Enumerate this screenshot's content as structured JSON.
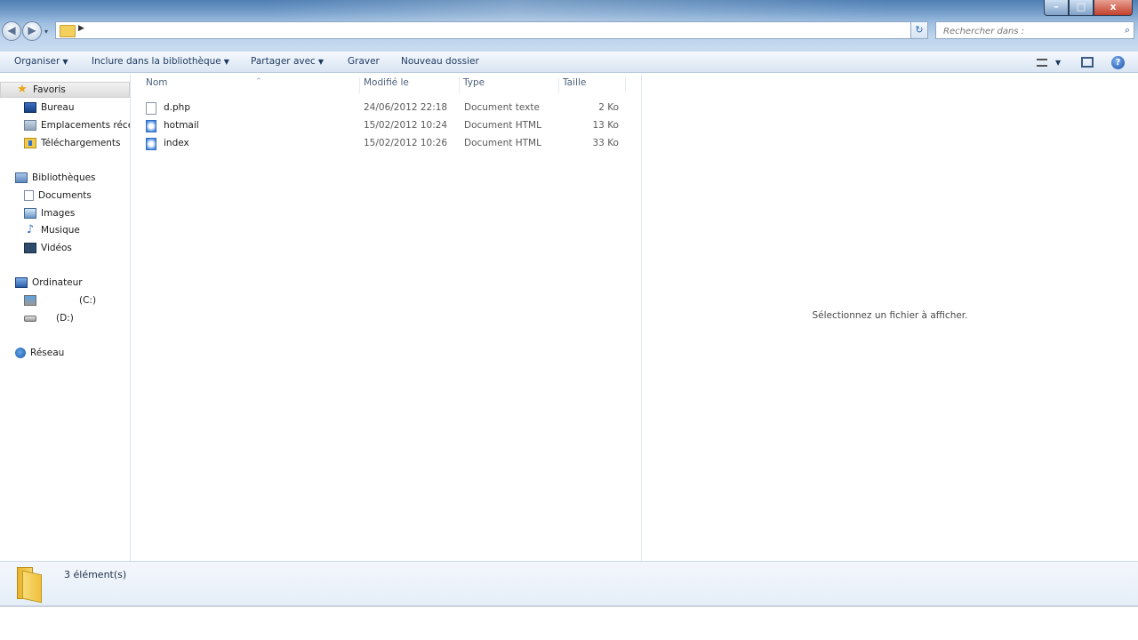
{
  "window": {
    "controls": {
      "minimize": "–",
      "maximize": "□",
      "close": "x"
    }
  },
  "navigation": {
    "back": "◀",
    "forward": "▶",
    "dropdown": "▾",
    "refresh": "↻"
  },
  "address": {
    "separator": "▶",
    "dropdown": "▾"
  },
  "search": {
    "placeholder": "Rechercher dans :"
  },
  "toolbar": {
    "organize": "Organiser",
    "include_library": "Inclure dans la bibliothèque",
    "share": "Partager avec",
    "burn": "Graver",
    "new_folder": "Nouveau dossier",
    "caret": "▼",
    "help": "?"
  },
  "nav": {
    "favorites": "Favoris",
    "desktop": "Bureau",
    "recent": "Emplacements récents",
    "downloads": "Téléchargements",
    "libraries": "Bibliothèques",
    "documents": "Documents",
    "images": "Images",
    "music": "Musique",
    "videos": "Vidéos",
    "computer": "Ordinateur",
    "drive_c": "(C:)",
    "drive_d": "(D:)",
    "network": "Réseau"
  },
  "columns": {
    "name": "Nom",
    "modified": "Modifié le",
    "type": "Type",
    "size": "Taille",
    "sort_indicator": "^"
  },
  "files": [
    {
      "name": "d.php",
      "modified": "24/06/2012 22:18",
      "type": "Document texte",
      "size": "2 Ko",
      "icon": "text-file-icon"
    },
    {
      "name": "hotmail",
      "modified": "15/02/2012 10:24",
      "type": "Document HTML",
      "size": "13 Ko",
      "icon": "html-file-icon"
    },
    {
      "name": "index",
      "modified": "15/02/2012 10:26",
      "type": "Document HTML",
      "size": "33 Ko",
      "icon": "html-file-icon"
    }
  ],
  "preview": {
    "message": "Sélectionnez un fichier à afficher."
  },
  "details": {
    "count": "3 élément(s)"
  }
}
